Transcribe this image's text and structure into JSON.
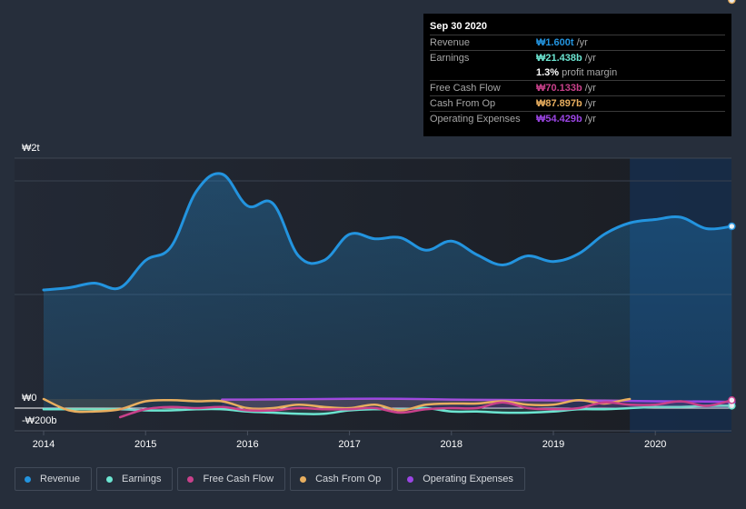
{
  "tooltip": {
    "date": "Sep 30 2020",
    "rows": [
      {
        "label": "Revenue",
        "value": "₩1.600t",
        "unit": "/yr",
        "color": "#2394df"
      },
      {
        "label": "Earnings",
        "value": "₩21.438b",
        "unit": "/yr",
        "color": "#6ce5d1"
      },
      {
        "label": "",
        "value": "1.3%",
        "unit": "profit margin",
        "color": "#ffffff"
      },
      {
        "label": "Free Cash Flow",
        "value": "₩70.133b",
        "unit": "/yr",
        "color": "#c9418b"
      },
      {
        "label": "Cash From Op",
        "value": "₩87.897b",
        "unit": "/yr",
        "color": "#e8ae5f"
      },
      {
        "label": "Operating Expenses",
        "value": "₩54.429b",
        "unit": "/yr",
        "color": "#9b45e4"
      }
    ]
  },
  "legend": [
    {
      "label": "Revenue",
      "color": "#2394df"
    },
    {
      "label": "Earnings",
      "color": "#6ce5d1"
    },
    {
      "label": "Free Cash Flow",
      "color": "#c9418b"
    },
    {
      "label": "Cash From Op",
      "color": "#e8ae5f"
    },
    {
      "label": "Operating Expenses",
      "color": "#9b45e4"
    }
  ],
  "chart_data": {
    "type": "line",
    "title": "",
    "xlabel": "",
    "ylabel": "",
    "units": "KRW trillions",
    "xlim": [
      2013.7,
      2020.75
    ],
    "ylim": [
      -0.2,
      2.2
    ],
    "y_ticks": [
      {
        "value": 2,
        "label": "₩2t"
      },
      {
        "value": 0,
        "label": "₩0"
      },
      {
        "value": -0.2,
        "label": "-₩200b"
      }
    ],
    "x_ticks": [
      {
        "value": 2014,
        "label": "2014"
      },
      {
        "value": 2015,
        "label": "2015"
      },
      {
        "value": 2016,
        "label": "2016"
      },
      {
        "value": 2017,
        "label": "2017"
      },
      {
        "value": 2018,
        "label": "2018"
      },
      {
        "value": 2019,
        "label": "2019"
      },
      {
        "value": 2020,
        "label": "2020"
      }
    ],
    "gridlines": [
      2,
      1
    ],
    "highlight_from": 2019.75,
    "series": [
      {
        "name": "Revenue",
        "color": "#2394df",
        "fill": true,
        "x": [
          2014.0,
          2014.25,
          2014.5,
          2014.75,
          2015.0,
          2015.25,
          2015.5,
          2015.75,
          2016.0,
          2016.25,
          2016.5,
          2016.75,
          2017.0,
          2017.25,
          2017.5,
          2017.75,
          2018.0,
          2018.25,
          2018.5,
          2018.75,
          2019.0,
          2019.25,
          2019.5,
          2019.75,
          2020.0,
          2020.25,
          2020.5,
          2020.75
        ],
        "values": [
          1.04,
          1.06,
          1.1,
          1.06,
          1.3,
          1.42,
          1.91,
          2.06,
          1.78,
          1.8,
          1.34,
          1.3,
          1.53,
          1.49,
          1.5,
          1.39,
          1.47,
          1.35,
          1.26,
          1.34,
          1.29,
          1.36,
          1.53,
          1.63,
          1.66,
          1.68,
          1.58,
          1.6
        ]
      },
      {
        "name": "Earnings",
        "color": "#6ce5d1",
        "fill": false,
        "x": [
          2014.0,
          2014.25,
          2014.5,
          2014.75,
          2015.0,
          2015.25,
          2015.5,
          2015.75,
          2016.0,
          2016.25,
          2016.5,
          2016.75,
          2017.0,
          2017.25,
          2017.5,
          2017.75,
          2018.0,
          2018.25,
          2018.5,
          2018.75,
          2019.0,
          2019.25,
          2019.5,
          2019.75,
          2020.0,
          2020.25,
          2020.5,
          2020.75
        ],
        "values": [
          -0.01,
          -0.01,
          -0.01,
          -0.01,
          -0.02,
          -0.02,
          -0.01,
          -0.01,
          -0.03,
          -0.04,
          -0.05,
          -0.05,
          -0.02,
          -0.01,
          -0.01,
          0.0,
          -0.03,
          -0.03,
          -0.04,
          -0.04,
          -0.03,
          -0.01,
          -0.01,
          0.0,
          0.01,
          0.01,
          0.02,
          0.021
        ]
      },
      {
        "name": "Free Cash Flow",
        "color": "#c9418b",
        "fill": false,
        "x": [
          2014.75,
          2015.0,
          2015.25,
          2015.5,
          2015.75,
          2016.0,
          2016.25,
          2016.5,
          2016.75,
          2017.0,
          2017.25,
          2017.5,
          2017.75,
          2018.0,
          2018.25,
          2018.5,
          2018.75,
          2019.0,
          2019.25,
          2019.5,
          2019.75,
          2020.0,
          2020.25,
          2020.5,
          2020.75
        ],
        "values": [
          -0.08,
          -0.01,
          0.01,
          0.0,
          0.01,
          -0.02,
          -0.02,
          0.0,
          -0.01,
          -0.01,
          0.0,
          -0.04,
          -0.01,
          0.0,
          0.0,
          0.05,
          0.0,
          -0.01,
          0.0,
          0.05,
          0.03,
          0.03,
          0.06,
          0.02,
          0.07
        ]
      },
      {
        "name": "Cash From Op",
        "color": "#e8ae5f",
        "fill": false,
        "x": [
          2014.0,
          2014.25,
          2014.5,
          2014.75,
          2015.0,
          2015.25,
          2015.5,
          2015.75,
          2016.0,
          2016.25,
          2016.5,
          2016.75,
          2017.0,
          2017.25,
          2017.5,
          2017.75,
          2018.0,
          2018.25,
          2018.5,
          2018.75,
          2019.0,
          2019.25,
          2019.5,
          2019.75,
          2020.0,
          2020.25,
          2020.5,
          2020.75
        ],
        "values": [
          0.08,
          -0.02,
          -0.03,
          -0.01,
          0.06,
          0.07,
          0.06,
          0.06,
          0.0,
          0.0,
          0.03,
          0.01,
          0.0,
          0.03,
          -0.02,
          0.03,
          0.04,
          0.04,
          0.06,
          0.03,
          0.03,
          0.07,
          0.04,
          0.08,
          0.088
        ]
      },
      {
        "name": "Operating Expenses",
        "color": "#9b45e4",
        "fill": false,
        "x": [
          2015.75,
          2016.0,
          2016.5,
          2017.0,
          2017.5,
          2018.0,
          2018.5,
          2019.0,
          2019.5,
          2020.0,
          2020.5,
          2020.75
        ],
        "values": [
          0.075,
          0.075,
          0.078,
          0.082,
          0.082,
          0.075,
          0.072,
          0.068,
          0.066,
          0.06,
          0.058,
          0.054
        ]
      }
    ]
  }
}
